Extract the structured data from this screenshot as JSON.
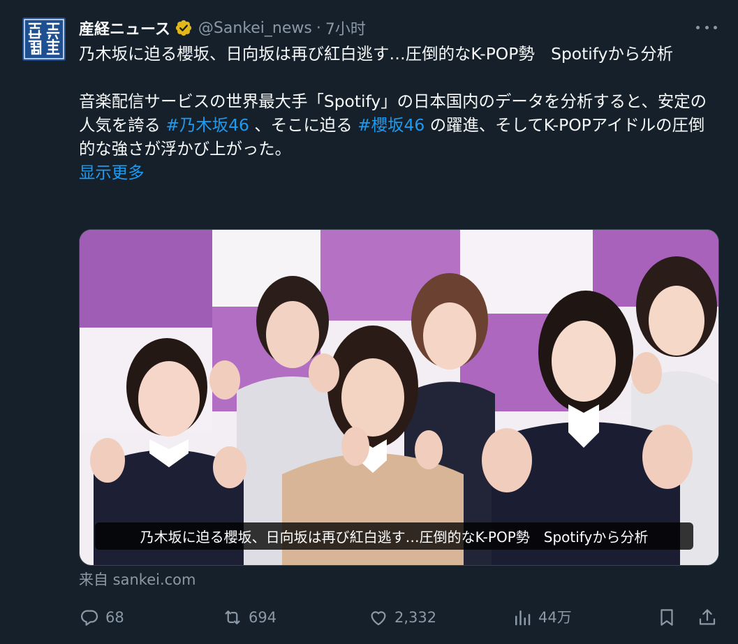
{
  "tweet": {
    "author_name": "産経ニュース",
    "handle": "@Sankei_news",
    "separator": "·",
    "time": "7小时",
    "title_line": "乃木坂に迫る櫻坂、日向坂は再び紅白逃す…圧倒的なK-POP勢　Spotifyから分析",
    "body_1": "音楽配信サービスの世界最大手「Spotify」の日本国内のデータを分析すると、安定の人気を誇る ",
    "hashtag_1": "#乃木坂46",
    "body_2": " 、そこに迫る ",
    "hashtag_2": "#櫻坂46",
    "body_3": " の躍進、そしてK-POPアイドルの圧倒的な強さが浮かび上がった。",
    "show_more": "显示更多"
  },
  "avatar": {
    "text": "産経新聞"
  },
  "card": {
    "caption": "乃木坂に迫る櫻坂、日向坂は再び紅白逃す…圧倒的なK-POP勢　Spotifyから分析",
    "source": "来自 sankei.com"
  },
  "actions": {
    "reply_count": "68",
    "retweet_count": "694",
    "like_count": "2,332",
    "views_count": "44万"
  },
  "icons": {
    "verified": "verified-badge-icon",
    "more": "more-icon",
    "reply": "reply-icon",
    "retweet": "retweet-icon",
    "like": "heart-icon",
    "views": "views-icon",
    "bookmark": "bookmark-icon",
    "share": "share-icon"
  },
  "colors": {
    "background": "#15202b",
    "text": "#f7f9f9",
    "secondary": "#8b98a5",
    "link": "#1d9bf0",
    "verified": "#e2b719"
  }
}
